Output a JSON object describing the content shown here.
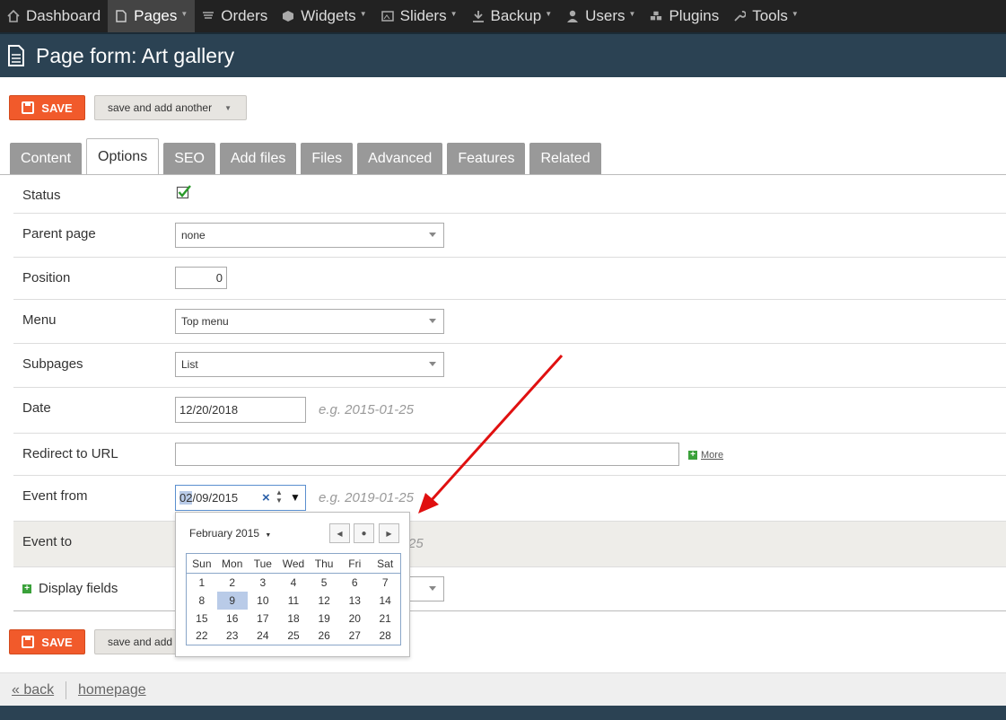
{
  "nav": {
    "items": [
      {
        "label": "Dashboard",
        "icon": "home-icon",
        "caret": false
      },
      {
        "label": "Pages",
        "icon": "page-icon",
        "caret": true
      },
      {
        "label": "Orders",
        "icon": "cart-icon",
        "caret": false
      },
      {
        "label": "Widgets",
        "icon": "cube-icon",
        "caret": true
      },
      {
        "label": "Sliders",
        "icon": "image-icon",
        "caret": true
      },
      {
        "label": "Backup",
        "icon": "download-icon",
        "caret": true
      },
      {
        "label": "Users",
        "icon": "user-icon",
        "caret": true
      },
      {
        "label": "Plugins",
        "icon": "cubes-icon",
        "caret": false
      },
      {
        "label": "Tools",
        "icon": "wrench-icon",
        "caret": true
      }
    ]
  },
  "header": {
    "title": "Page form: Art gallery"
  },
  "toolbar": {
    "save_label": "SAVE",
    "save_add_label": "save and add another"
  },
  "tabs": [
    "Content",
    "Options",
    "SEO",
    "Add files",
    "Files",
    "Advanced",
    "Features",
    "Related"
  ],
  "form": {
    "status_label": "Status",
    "parent_label": "Parent page",
    "parent_value": "none",
    "position_label": "Position",
    "position_value": "0",
    "menu_label": "Menu",
    "menu_value": "Top menu",
    "subpages_label": "Subpages",
    "subpages_value": "List",
    "date_label": "Date",
    "date_value": "12/20/2018",
    "date_hint": "e.g. 2015-01-25",
    "redirect_label": "Redirect to URL",
    "redirect_value": "",
    "more_label": "More",
    "event_from_label": "Event from",
    "event_from_value_sel": "02",
    "event_from_value_rest": "/09/2015",
    "event_from_hint": "e.g. 2019-01-25",
    "event_to_label": "Event to",
    "event_to_hint_tail": "25",
    "display_fields_label": "Display fields"
  },
  "calendar": {
    "month": "February 2015",
    "weekdays": [
      "Sun",
      "Mon",
      "Tue",
      "Wed",
      "Thu",
      "Fri",
      "Sat"
    ],
    "weeks": [
      [
        "1",
        "2",
        "3",
        "4",
        "5",
        "6",
        "7"
      ],
      [
        "8",
        "9",
        "10",
        "11",
        "12",
        "13",
        "14"
      ],
      [
        "15",
        "16",
        "17",
        "18",
        "19",
        "20",
        "21"
      ],
      [
        "22",
        "23",
        "24",
        "25",
        "26",
        "27",
        "28"
      ]
    ],
    "selected": "9"
  },
  "footer": {
    "back_label": "« back",
    "home_label": "homepage"
  },
  "colors": {
    "accent": "#f15a2b",
    "header": "#2b4253",
    "arrow": "#e01010"
  }
}
